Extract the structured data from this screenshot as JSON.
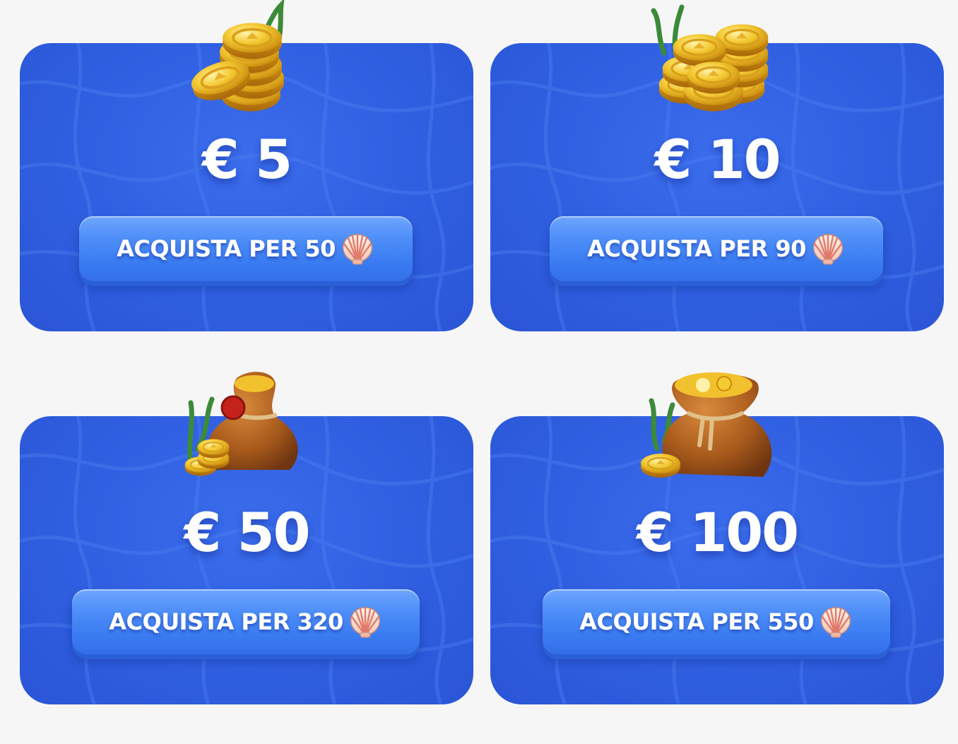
{
  "offers": [
    {
      "price": "€ 5",
      "button_label": "ACQUISTA PER 50",
      "currency_icon": "shell-icon",
      "illustration": "gold-coins-stack-icon"
    },
    {
      "price": "€ 10",
      "button_label": "ACQUISTA PER 90",
      "currency_icon": "shell-icon",
      "illustration": "gold-coins-pile-icon"
    },
    {
      "price": "€ 50",
      "button_label": "ACQUISTA PER 320",
      "currency_icon": "shell-icon",
      "illustration": "coin-sack-small-icon"
    },
    {
      "price": "€ 100",
      "button_label": "ACQUISTA PER 550",
      "currency_icon": "shell-icon",
      "illustration": "coin-sack-large-icon"
    }
  ],
  "colors": {
    "page_background": "#f6f6f7",
    "card_background": "#2f5fe0",
    "button_background": "#4d8ef8",
    "text": "#ffffff",
    "coin_gold": "#f2c12e"
  }
}
